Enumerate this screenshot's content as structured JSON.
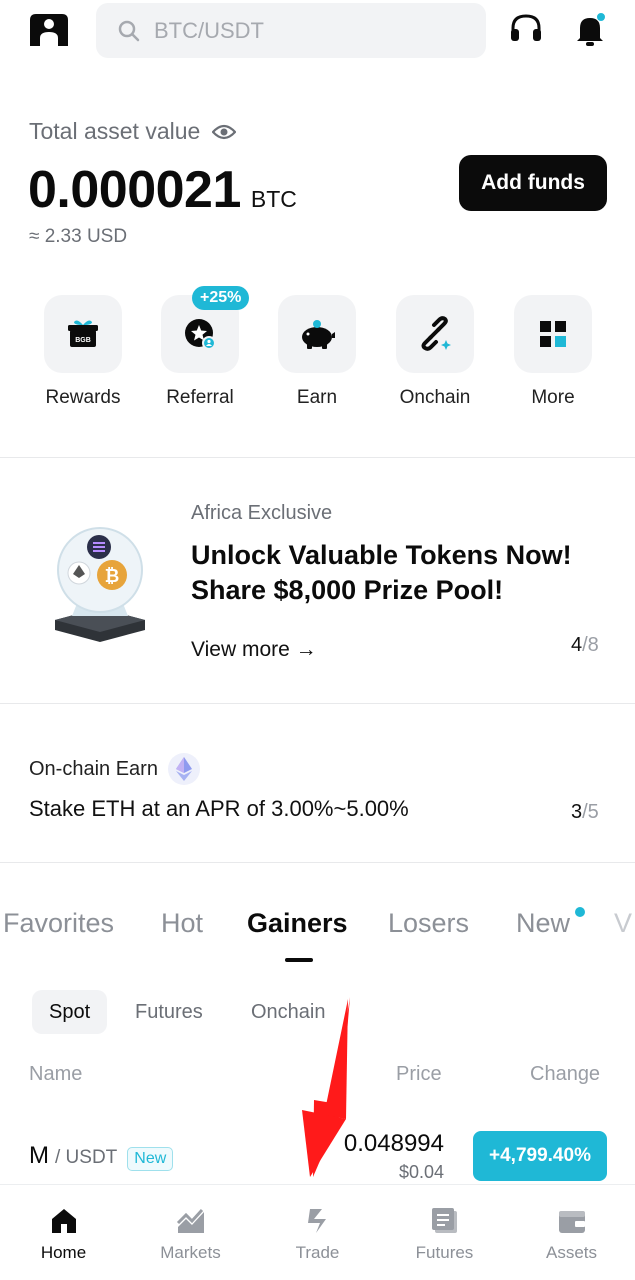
{
  "header": {
    "search_placeholder": "BTC/USDT"
  },
  "asset": {
    "label": "Total asset value",
    "value": "0.000021",
    "unit": "BTC",
    "usd": "≈ 2.33 USD",
    "add_funds": "Add funds"
  },
  "quick_actions": [
    {
      "label": "Rewards",
      "icon": "gift-box-icon"
    },
    {
      "label": "Referral",
      "icon": "referral-star-icon",
      "badge": "+25%"
    },
    {
      "label": "Earn",
      "icon": "piggy-bank-icon"
    },
    {
      "label": "Onchain",
      "icon": "chain-link-icon"
    },
    {
      "label": "More",
      "icon": "grid-icon"
    }
  ],
  "promo": {
    "tag": "Africa Exclusive",
    "title": "Unlock Valuable Tokens Now! Share $8,000 Prize Pool!",
    "link": "View more →",
    "page_current": "4",
    "page_total": "/8"
  },
  "earn": {
    "tag": "On-chain Earn",
    "title": "Stake ETH at an APR of 3.00%~5.00%",
    "page_current": "3",
    "page_total": "/5"
  },
  "market": {
    "tabs": [
      "Favorites",
      "Hot",
      "Gainers",
      "Losers",
      "New",
      "V"
    ],
    "active_tab": "Gainers",
    "subtabs": [
      "Spot",
      "Futures",
      "Onchain"
    ],
    "active_subtab": "Spot",
    "columns": {
      "name": "Name",
      "price": "Price",
      "change": "Change"
    },
    "rows": [
      {
        "symbol": "M",
        "quote": "/ USDT",
        "badge": "New",
        "price": "0.048994",
        "price_usd": "$0.04",
        "change": "+4,799.40%"
      }
    ]
  },
  "nav": [
    {
      "label": "Home",
      "icon": "home-icon"
    },
    {
      "label": "Markets",
      "icon": "markets-chart-icon"
    },
    {
      "label": "Trade",
      "icon": "trade-icon"
    },
    {
      "label": "Futures",
      "icon": "futures-icon"
    },
    {
      "label": "Assets",
      "icon": "wallet-icon"
    }
  ],
  "colors": {
    "accent": "#1fb8d6",
    "dark": "#0b0b0b",
    "annotation_arrow": "#ff1a1a"
  }
}
